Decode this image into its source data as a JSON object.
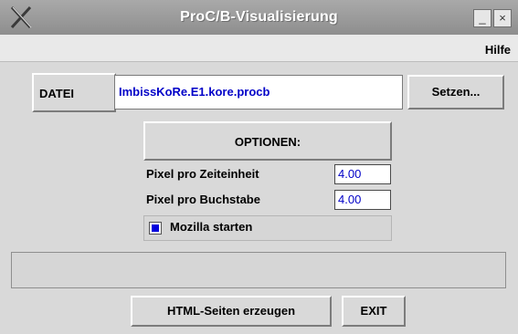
{
  "window": {
    "title": "ProC/B-Visualisierung",
    "minimize_glyph": "_",
    "close_glyph": "×"
  },
  "menu": {
    "help": "Hilfe"
  },
  "file": {
    "label": "DATEI",
    "value": "ImbissKoRe.E1.kore.procb",
    "set_button": "Setzen..."
  },
  "options": {
    "header": "OPTIONEN:",
    "pixel_per_time_label": "Pixel pro Zeiteinheit",
    "pixel_per_time_value": "4.00",
    "pixel_per_char_label": "Pixel pro Buchstabe",
    "pixel_per_char_value": "4.00",
    "start_mozilla_label": "Mozilla starten",
    "start_mozilla_checked": true
  },
  "status": {
    "text": ""
  },
  "actions": {
    "generate": "HTML-Seiten erzeugen",
    "exit": "EXIT"
  },
  "colors": {
    "field_text": "#0000c8",
    "checkbox_fill": "#0000dd",
    "titlebar": "#9a9a9a"
  },
  "icons": {
    "app": "x-window-icon",
    "minimize": "minimize-icon",
    "close": "close-icon"
  }
}
